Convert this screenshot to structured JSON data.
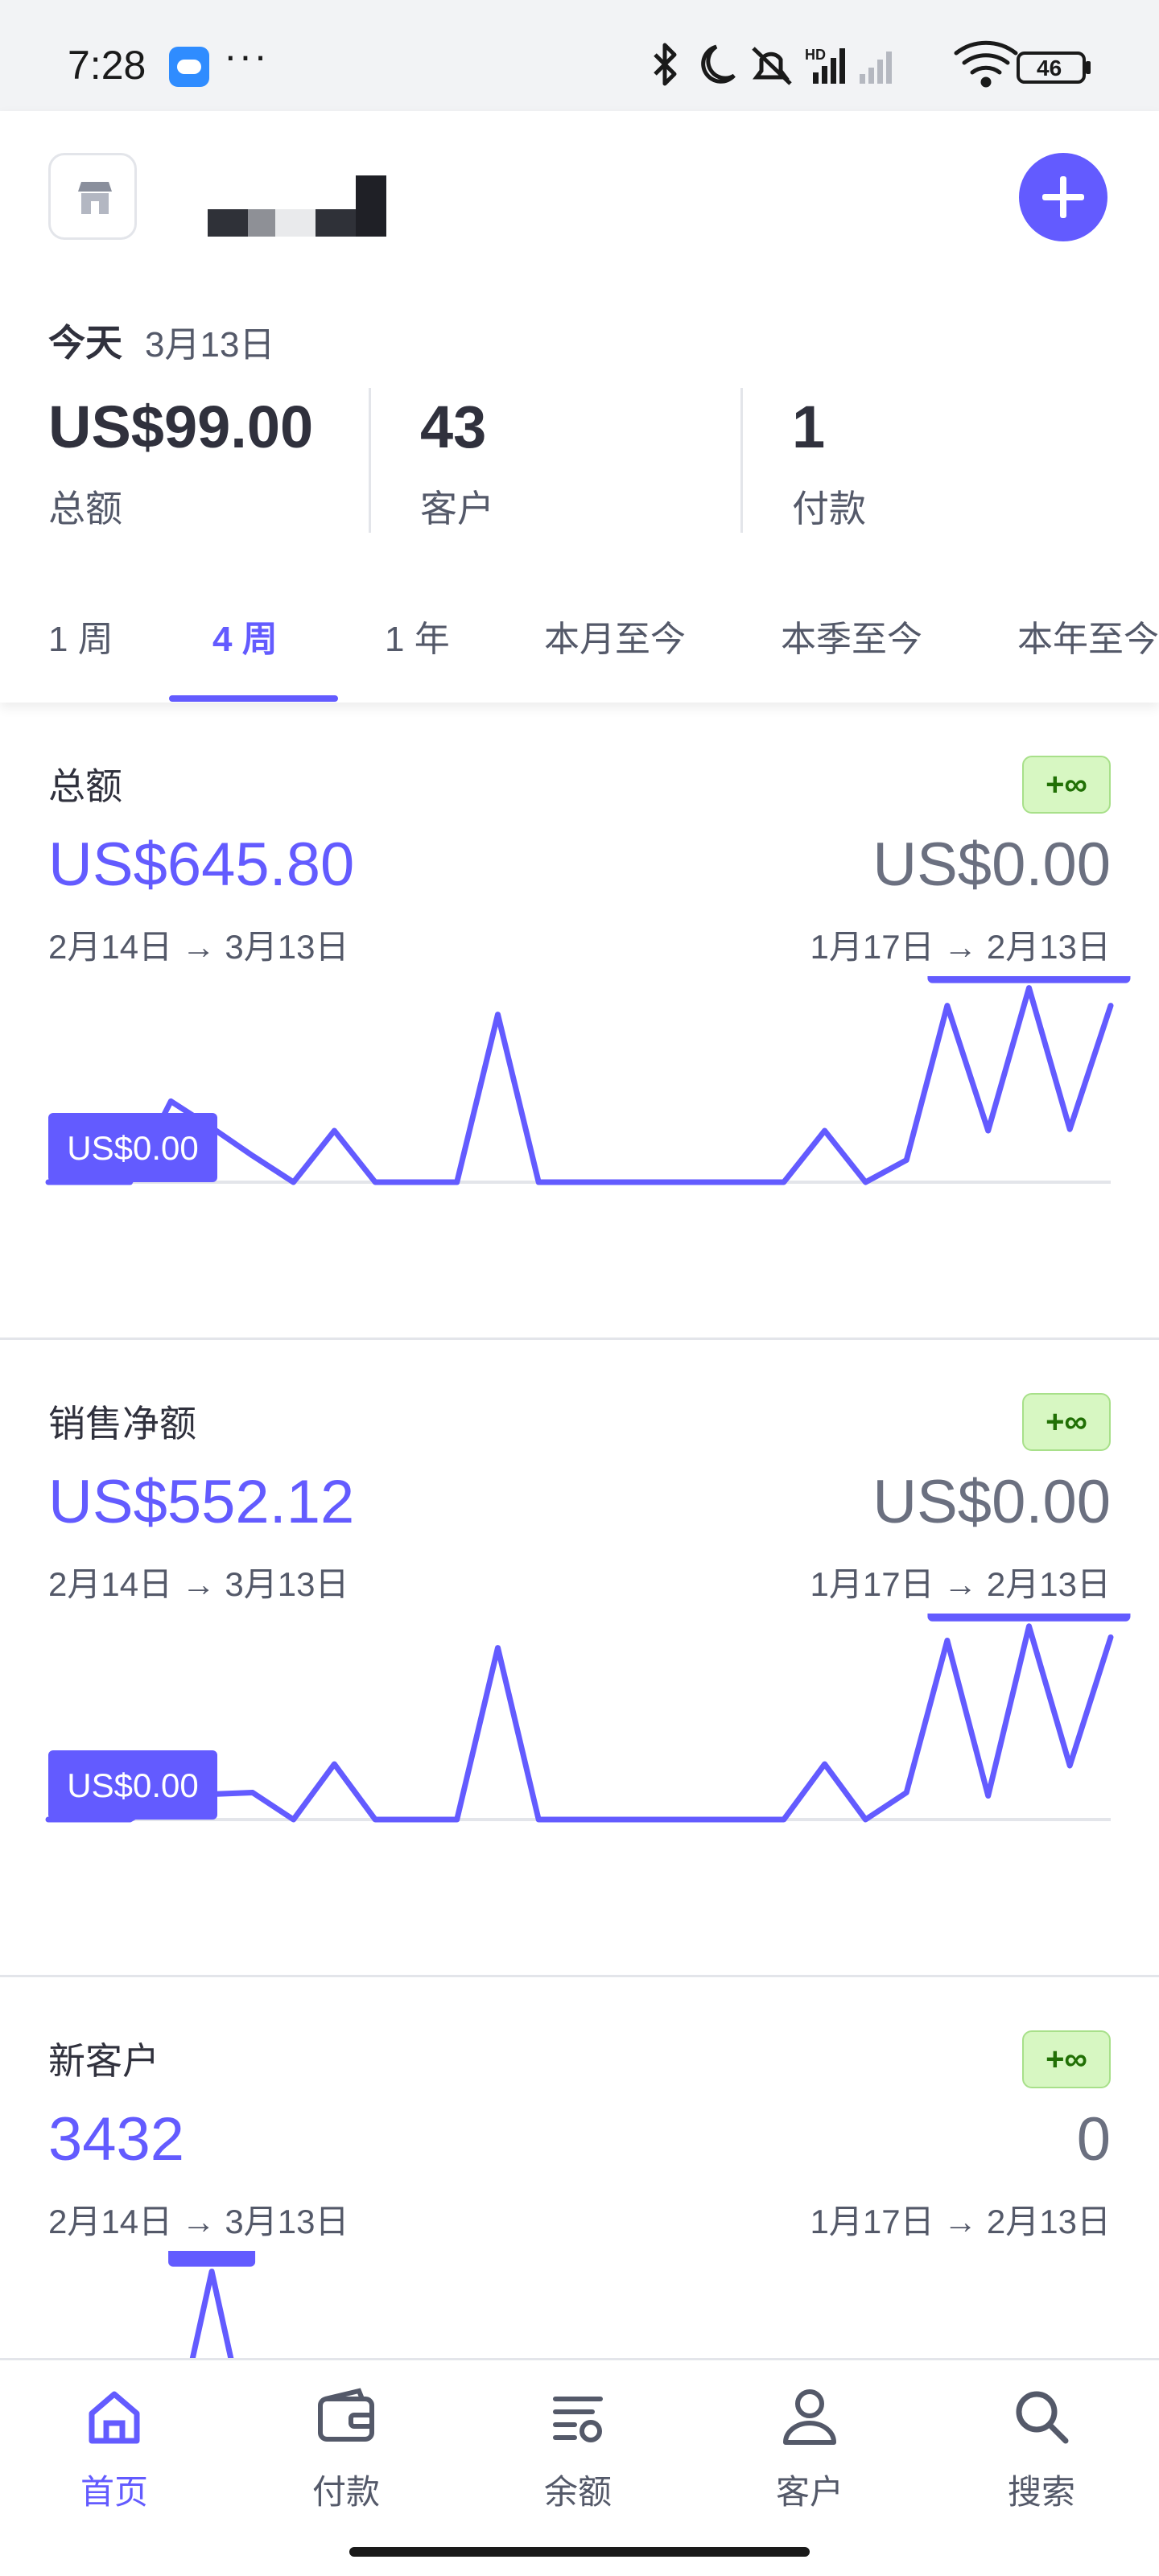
{
  "status_bar": {
    "time": "7:28",
    "dots": "···",
    "battery": "46",
    "icons": [
      "cloud-app-icon",
      "bluetooth-icon",
      "moon-icon",
      "mute-icon",
      "hd-signal-icon",
      "signal-icon",
      "wifi-icon",
      "battery-icon"
    ]
  },
  "header": {
    "add_icon": "plus-icon",
    "store_icon": "store-icon"
  },
  "today": {
    "label": "今天",
    "date": "3月13日",
    "summary": [
      {
        "value": "US$99.00",
        "label": "总额"
      },
      {
        "value": "43",
        "label": "客户"
      },
      {
        "value": "1",
        "label": "付款"
      }
    ]
  },
  "tabs": [
    "1 周",
    "4 周",
    "1 年",
    "本月至今",
    "本季至今",
    "本年至今"
  ],
  "active_tab": "4 周",
  "colors": {
    "accent": "#635bff",
    "badge_bg": "#d7f7c2",
    "badge_text": "#217005"
  },
  "cards": [
    {
      "title": "总额",
      "badge": "+∞",
      "current_value": "US$645.80",
      "current_range": "2月14日 → 3月13日",
      "previous_value": "US$0.00",
      "previous_range": "1月17日 → 2月13日",
      "peak_label": "US$113.99",
      "min_label": "US$0.00"
    },
    {
      "title": "销售净额",
      "badge": "+∞",
      "current_value": "US$552.12",
      "current_range": "2月14日 → 3月13日",
      "previous_value": "US$0.00",
      "previous_range": "1月17日 → 2月13日",
      "peak_label": "US$108.37",
      "min_label": "US$0.00"
    },
    {
      "title": "新客户",
      "badge": "+∞",
      "current_value": "3432",
      "current_range": "2月14日 → 3月13日",
      "previous_value": "0",
      "previous_range": "1月17日 → 2月13日",
      "peak_label": "270"
    }
  ],
  "chart_data": [
    {
      "type": "line",
      "series": [
        {
          "values": [
            0,
            0,
            0,
            55,
            37,
            18,
            0,
            35,
            0,
            0,
            0,
            113.99,
            0,
            0,
            0,
            0,
            0,
            0,
            0,
            35,
            0,
            15,
            120,
            35,
            132,
            36,
            120
          ]
        }
      ],
      "ylim": [
        0,
        140
      ]
    },
    {
      "type": "line",
      "series": [
        {
          "values": [
            0,
            0,
            0,
            15,
            16,
            17,
            0,
            35,
            0,
            0,
            0,
            108.37,
            0,
            0,
            0,
            0,
            0,
            0,
            0,
            35,
            0,
            17,
            113,
            15,
            122,
            34,
            115
          ]
        }
      ],
      "ylim": [
        0,
        130
      ]
    },
    {
      "type": "line",
      "series": [
        {
          "values": [
            0,
            0,
            0,
            0,
            270,
            0,
            0,
            0,
            0,
            0,
            0,
            0,
            0,
            0,
            0,
            0,
            0,
            0,
            60,
            65,
            55,
            40,
            30,
            20,
            50,
            45,
            30
          ]
        }
      ],
      "ylim": [
        0,
        300
      ]
    }
  ],
  "nav": [
    {
      "label": "首页",
      "icon": "home-icon"
    },
    {
      "label": "付款",
      "icon": "wallet-icon"
    },
    {
      "label": "余额",
      "icon": "balance-icon"
    },
    {
      "label": "客户",
      "icon": "person-icon"
    },
    {
      "label": "搜索",
      "icon": "search-icon"
    }
  ]
}
